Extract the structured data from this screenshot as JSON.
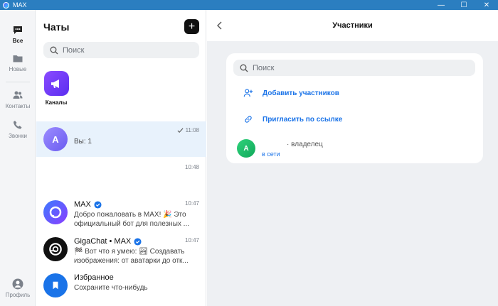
{
  "window": {
    "title": "MAX",
    "minimize": "—",
    "maximize": "☐",
    "close": "✕"
  },
  "rail": {
    "items": [
      {
        "label": "Все"
      },
      {
        "label": "Новые"
      },
      {
        "label": "Контакты"
      },
      {
        "label": "Звонки"
      }
    ],
    "profile_label": "Профиль"
  },
  "chats": {
    "header": "Чаты",
    "new_chat": "+",
    "search_placeholder": "Поиск",
    "channels_label": "Каналы",
    "list": [
      {
        "name": "",
        "avatar_letter": "A",
        "preview": "Вы: 1",
        "time": "11:08",
        "read": true
      },
      {
        "name": "",
        "avatar_letter": "",
        "preview": "",
        "time": "10:48"
      },
      {
        "name": "MAX",
        "preview": "Добро пожаловать в MAX! 🎉 Это официальный бот для полезных ...",
        "time": "10:47",
        "verified": true
      },
      {
        "name": "GigaChat • MAX",
        "preview": "🏁 Вот что я умею: 🏞 Создавать изображения: от аватарки до отк...",
        "time": "10:47",
        "verified": true
      },
      {
        "name": "Избранное",
        "preview": "Сохраните что-нибудь",
        "time": ""
      }
    ]
  },
  "participants": {
    "title": "Участники",
    "search_placeholder": "Поиск",
    "add_label": "Добавить участников",
    "invite_label": "Пригласить по ссылке",
    "member": {
      "avatar_letter": "A",
      "role": "· владелец",
      "status": "в сети"
    }
  },
  "colors": {
    "accent": "#1a73e8",
    "titlebar": "#2b7ec0",
    "selected_row": "#e8f2fc"
  }
}
